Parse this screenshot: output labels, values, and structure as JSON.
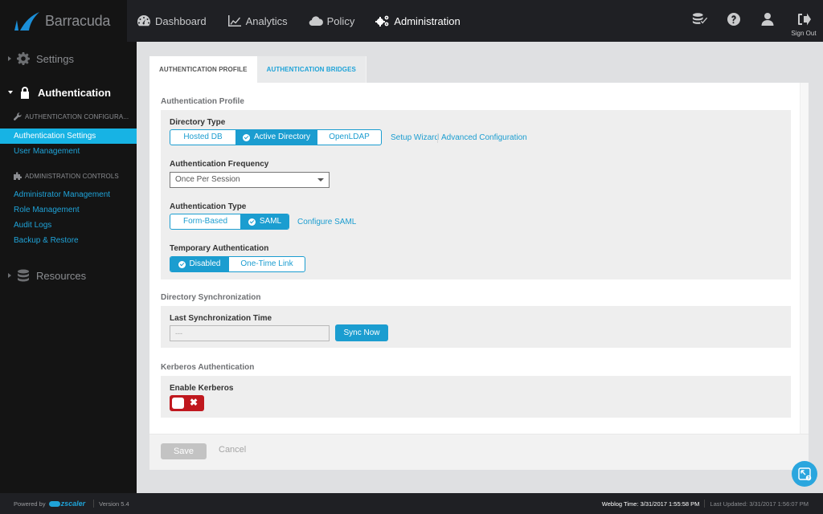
{
  "brand": {
    "name": "Barracuda",
    "color": "#1b8fd8"
  },
  "nav": [
    {
      "label": "Dashboard",
      "icon": "dashboard-icon"
    },
    {
      "label": "Analytics",
      "icon": "chart-line-icon"
    },
    {
      "label": "Policy",
      "icon": "cloud-icon"
    },
    {
      "label": "Administration",
      "icon": "gears-icon",
      "active": true
    }
  ],
  "top_actions": {
    "database_check": "database-check-icon",
    "help": "help-icon",
    "user": "user-icon",
    "sign_out_label": "Sign Out"
  },
  "sidebar": {
    "settings": "Settings",
    "authentication": "Authentication",
    "auth_config_header": "AUTHENTICATION CONFIGURA...",
    "auth_links": [
      "Authentication Settings",
      "User Management"
    ],
    "admin_controls_header": "ADMINISTRATION CONTROLS",
    "admin_links": [
      "Administrator Management",
      "Role Management",
      "Audit Logs",
      "Backup & Restore"
    ],
    "resources": "Resources"
  },
  "tabs": [
    "AUTHENTICATION PROFILE",
    "AUTHENTICATION BRIDGES"
  ],
  "profile": {
    "section_title": "Authentication Profile",
    "directory_type": {
      "label": "Directory Type",
      "options": [
        "Hosted DB",
        "Active Directory",
        "OpenLDAP"
      ],
      "selected": "Active Directory",
      "links": [
        "Setup Wizard",
        "Advanced Configuration"
      ]
    },
    "auth_frequency": {
      "label": "Authentication Frequency",
      "value": "Once Per Session"
    },
    "auth_type": {
      "label": "Authentication Type",
      "options": [
        "Form-Based",
        "SAML"
      ],
      "selected": "SAML",
      "link": "Configure SAML"
    },
    "temp_auth": {
      "label": "Temporary Authentication",
      "options": [
        "Disabled",
        "One-Time Link"
      ],
      "selected": "Disabled"
    }
  },
  "sync": {
    "section_title": "Directory Synchronization",
    "label": "Last Synchronization Time",
    "value": "---",
    "button": "Sync Now"
  },
  "kerberos": {
    "section_title": "Kerberos Authentication",
    "label": "Enable Kerberos",
    "enabled": false
  },
  "actions": {
    "save": "Save",
    "cancel": "Cancel"
  },
  "footer": {
    "powered_by": "Powered by",
    "partner": "zscaler",
    "version": "Version 5.4",
    "weblog_time": "Weblog Time: 3/31/2017 1:55:58 PM",
    "last_updated": "Last Updated: 3/31/2017 1:56:07 PM"
  }
}
